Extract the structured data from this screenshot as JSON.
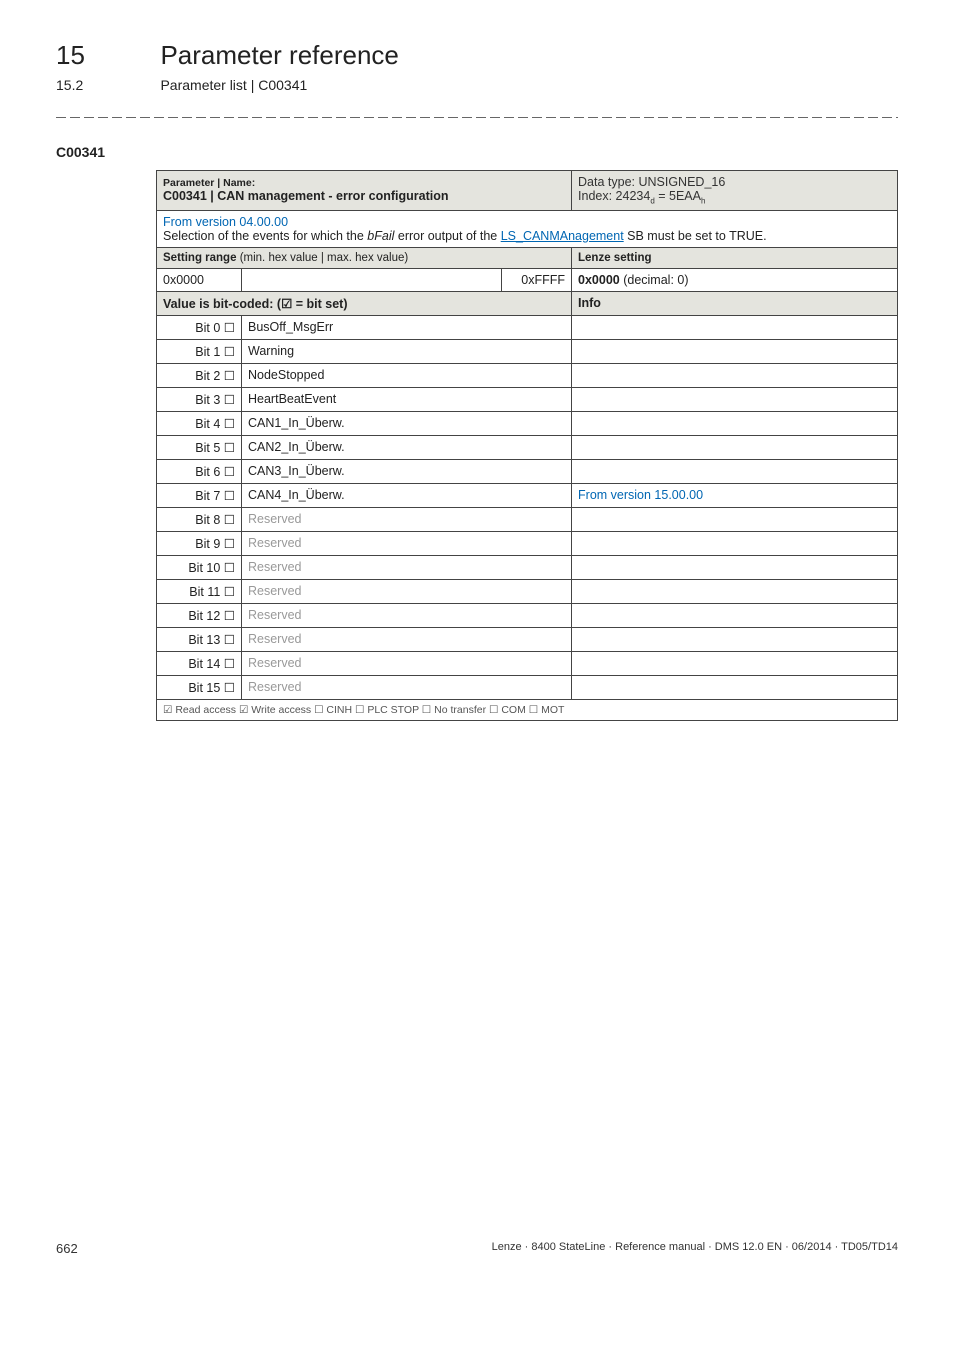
{
  "header": {
    "chapter_num": "15",
    "chapter_title": "Parameter reference",
    "subsection_num": "15.2",
    "subsection_title": "Parameter list | C00341"
  },
  "anchor": "C00341",
  "table": {
    "param_name_label": "Parameter | Name:",
    "param_name_value": "C00341 | CAN management - error configuration",
    "data_type_line1": "Data type: UNSIGNED_16",
    "data_type_line2_prefix": "Index: 24234",
    "data_type_line2_sub1": "d",
    "data_type_line2_mid": " = 5EAA",
    "data_type_line2_sub2": "h",
    "from_version": "From version 04.00.00",
    "selection_text_pre": "Selection of the events for which the ",
    "selection_text_ital": "bFail",
    "selection_text_mid": " error output of the ",
    "selection_text_link": "LS_CANMAnagement",
    "selection_text_post": " SB must be set to TRUE.",
    "setting_range_label_bold": "Setting range ",
    "setting_range_label_rest": "(min. hex value | max. hex value)",
    "lenze_setting_label": "Lenze setting",
    "range_min": "0x0000",
    "range_max": "0xFFFF",
    "default_bold": "0x0000",
    "default_rest": "  (decimal: 0)",
    "bitcoded_label": "Value is bit-coded:  (☑ = bit set)",
    "info_label": "Info",
    "bits": [
      {
        "n": "Bit 0  ☐",
        "label": "BusOff_MsgErr",
        "info": "",
        "grey": false
      },
      {
        "n": "Bit 1  ☐",
        "label": "Warning",
        "info": "",
        "grey": false
      },
      {
        "n": "Bit 2  ☐",
        "label": "NodeStopped",
        "info": "",
        "grey": false
      },
      {
        "n": "Bit 3  ☐",
        "label": "HeartBeatEvent",
        "info": "",
        "grey": false
      },
      {
        "n": "Bit 4  ☐",
        "label": "CAN1_In_Überw.",
        "info": "",
        "grey": false
      },
      {
        "n": "Bit 5  ☐",
        "label": "CAN2_In_Überw.",
        "info": "",
        "grey": false
      },
      {
        "n": "Bit 6  ☐",
        "label": "CAN3_In_Überw.",
        "info": "",
        "grey": false
      },
      {
        "n": "Bit 7  ☐",
        "label": "CAN4_In_Überw.",
        "info": "From version 15.00.00",
        "grey": false
      },
      {
        "n": "Bit 8  ☐",
        "label": "Reserved",
        "info": "",
        "grey": true
      },
      {
        "n": "Bit 9  ☐",
        "label": "Reserved",
        "info": "",
        "grey": true
      },
      {
        "n": "Bit 10  ☐",
        "label": "Reserved",
        "info": "",
        "grey": true
      },
      {
        "n": "Bit 11  ☐",
        "label": "Reserved",
        "info": "",
        "grey": true
      },
      {
        "n": "Bit 12  ☐",
        "label": "Reserved",
        "info": "",
        "grey": true
      },
      {
        "n": "Bit 13  ☐",
        "label": "Reserved",
        "info": "",
        "grey": true
      },
      {
        "n": "Bit 14  ☐",
        "label": "Reserved",
        "info": "",
        "grey": true
      },
      {
        "n": "Bit 15  ☐",
        "label": "Reserved",
        "info": "",
        "grey": true
      }
    ],
    "access_footer": "☑ Read access   ☑ Write access   ☐ CINH   ☐ PLC STOP   ☐ No transfer   ☐ COM   ☐ MOT"
  },
  "footer": {
    "page": "662",
    "doc": "Lenze · 8400 StateLine · Reference manual · DMS 12.0 EN · 06/2014 · TD05/TD14"
  }
}
